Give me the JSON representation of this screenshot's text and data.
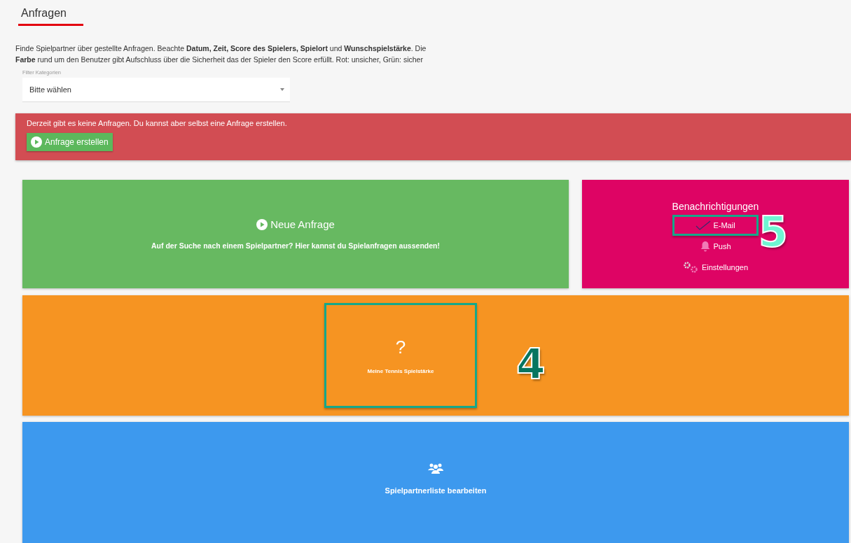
{
  "page": {
    "title": "Anfragen",
    "description_lines": [
      "Finde Spielpartner über gestellte Anfragen. Beachte **Datum, Zeit, Score des Spielers, Spielort** und **Wunschspielstärke**. Die",
      "**Farbe** rund um den Benutzer gibt Aufschluss über die Sicherheit das der Spieler den Score erfüllt. Rot: unsicher, Grün: sicher"
    ]
  },
  "filter": {
    "label": "Filter Kategorien",
    "value": "Bitte wählen"
  },
  "alert": {
    "message": "Derzeit gibt es keine Anfragen. Du kannst aber selbst eine Anfrage erstellen.",
    "button": "Anfrage erstellen"
  },
  "new_request": {
    "title": "Neue Anfrage",
    "subtitle": "Auf der Suche nach einem Spielpartner? Hier kannst du Spielanfragen aussenden!"
  },
  "notifications": {
    "title": "Benachrichtigungen",
    "callout": "5",
    "items": [
      {
        "kind": "check",
        "label": "E-Mail",
        "highlighted": true
      },
      {
        "kind": "bell",
        "label": "Push",
        "highlighted": false
      },
      {
        "kind": "gears",
        "label": "Einstellungen",
        "highlighted": false
      }
    ]
  },
  "skill": {
    "symbol": "?",
    "label": "Meine Tennis Spielstärke",
    "callout": "4",
    "highlighted": true
  },
  "partners": {
    "label": "Spielpartnerliste bearbeiten"
  }
}
